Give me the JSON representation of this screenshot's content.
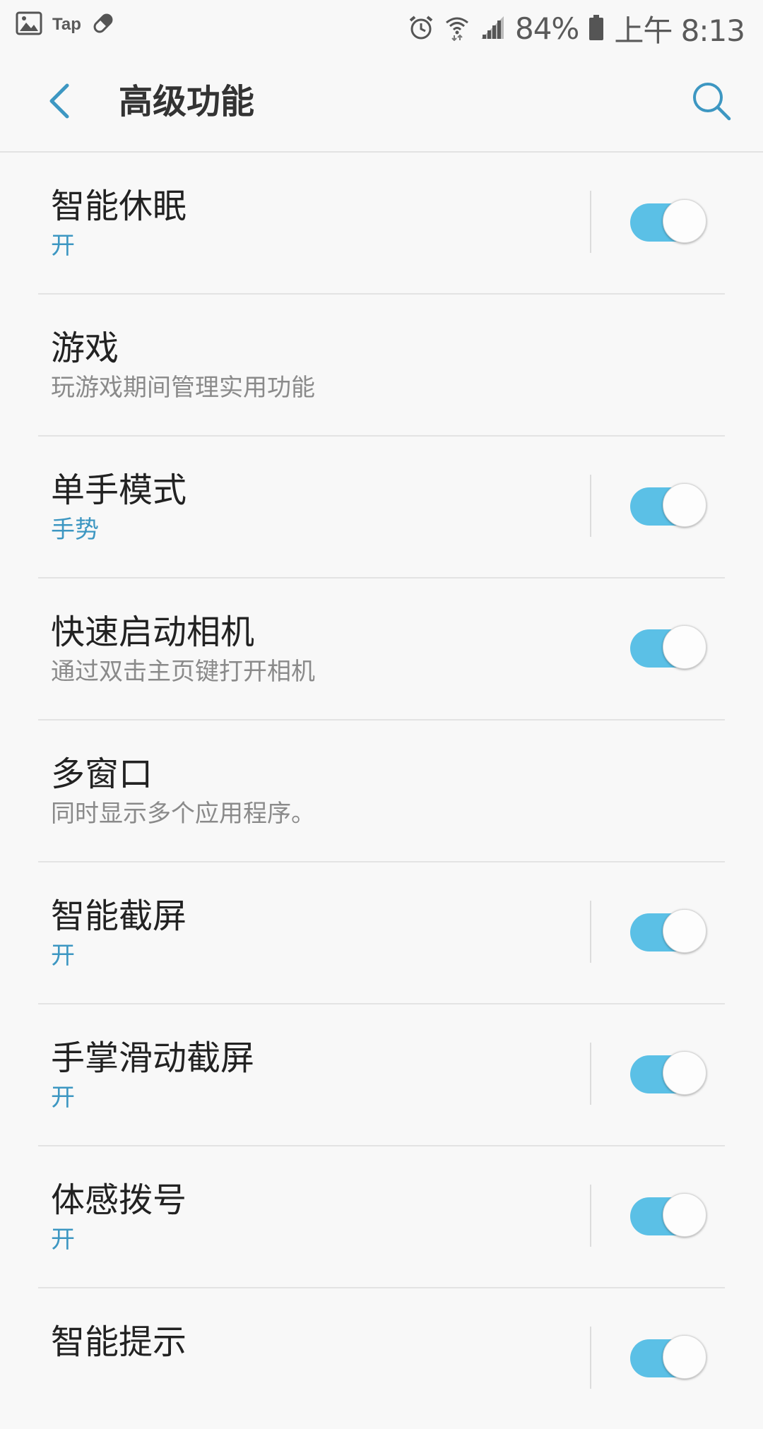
{
  "status_bar": {
    "notification_app_label": "Tap",
    "battery_percent": "84%",
    "time": "上午 8:13",
    "icons": [
      "image-icon",
      "pill-icon",
      "alarm-icon",
      "wifi-icon",
      "signal-icon",
      "battery-icon"
    ]
  },
  "header": {
    "title": "高级功能",
    "back_icon": "chevron-left-icon",
    "search_icon": "search-icon"
  },
  "colors": {
    "accent": "#3d97c2",
    "toggle_on": "#5bc0e6",
    "background": "#f8f8f8"
  },
  "settings": [
    {
      "title": "智能休眠",
      "subtitle": "开",
      "subtitle_accent": true,
      "has_toggle": true,
      "toggle_on": true
    },
    {
      "title": "游戏",
      "subtitle": "玩游戏期间管理实用功能",
      "subtitle_accent": false,
      "has_toggle": false
    },
    {
      "title": "单手模式",
      "subtitle": "手势",
      "subtitle_accent": true,
      "has_toggle": true,
      "toggle_on": true
    },
    {
      "title": "快速启动相机",
      "subtitle": "通过双击主页键打开相机",
      "subtitle_accent": false,
      "has_toggle": true,
      "toggle_on": true
    },
    {
      "title": "多窗口",
      "subtitle": "同时显示多个应用程序。",
      "subtitle_accent": false,
      "has_toggle": false
    },
    {
      "title": "智能截屏",
      "subtitle": "开",
      "subtitle_accent": true,
      "has_toggle": true,
      "toggle_on": true
    },
    {
      "title": "手掌滑动截屏",
      "subtitle": "开",
      "subtitle_accent": true,
      "has_toggle": true,
      "toggle_on": true
    },
    {
      "title": "体感拨号",
      "subtitle": "开",
      "subtitle_accent": true,
      "has_toggle": true,
      "toggle_on": true
    },
    {
      "title": "智能提示",
      "subtitle": "",
      "subtitle_accent": true,
      "has_toggle": true,
      "toggle_on": true
    }
  ]
}
